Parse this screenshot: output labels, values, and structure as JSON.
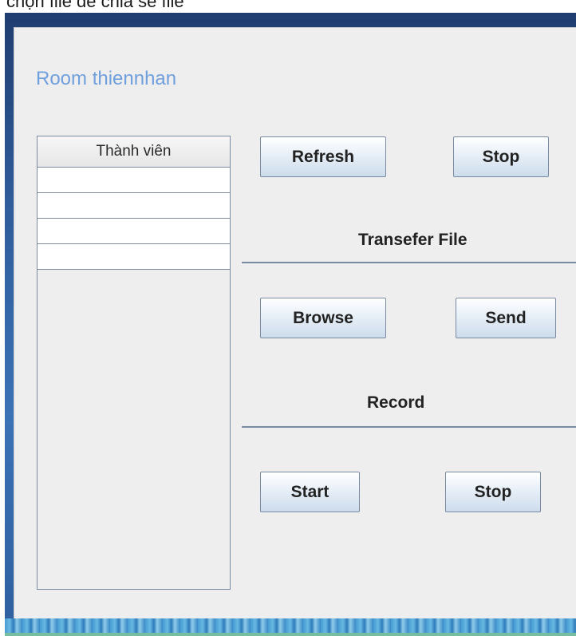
{
  "top_caption": "chọn file để chia sẻ file",
  "room": {
    "title": "Room thiennhan"
  },
  "members": {
    "header": "Thành viên",
    "rows": [
      "",
      "",
      "",
      ""
    ]
  },
  "controls": {
    "refresh_label": "Refresh",
    "stop_label": "Stop"
  },
  "transfer": {
    "title": "Transefer File",
    "browse_label": "Browse",
    "send_label": "Send"
  },
  "record": {
    "title": "Record",
    "start_label": "Start",
    "stop_label": "Stop"
  },
  "colors": {
    "title_blue": "#6f9fdc",
    "panel_bg": "#eeeeee",
    "frame_blue": "#2f5c9a"
  }
}
